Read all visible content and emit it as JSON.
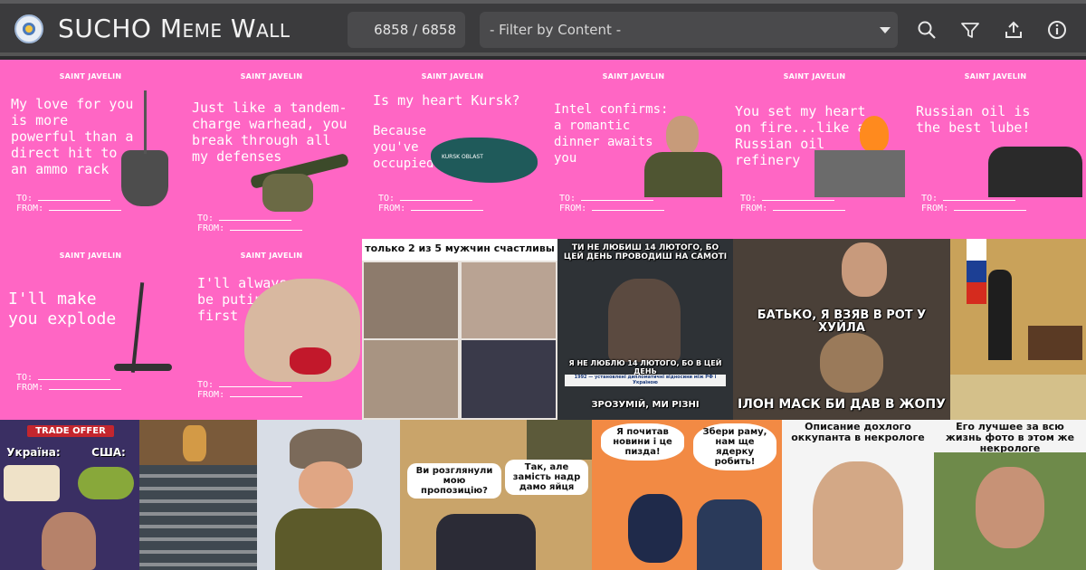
{
  "header": {
    "title": "SUCHO Meme Wall",
    "counter": "6858 / 6858",
    "filter_value": "- Filter by Content -",
    "icons": [
      "search-icon",
      "filter-icon",
      "upload-icon",
      "info-icon"
    ]
  },
  "colors": {
    "accent_pink": "#ff66c4",
    "header_bg": "#3b3b3d"
  },
  "cards": [
    {
      "brand": "SAINT JAVELIN",
      "text": "My love for you is more powerful than a direct hit to an ammo rack",
      "to": "TO:",
      "from": "FROM:"
    },
    {
      "brand": "SAINT JAVELIN",
      "text": "Just like a tandem-charge warhead, you break through all my defenses",
      "to": "TO:",
      "from": "FROM:"
    },
    {
      "brand": "SAINT JAVELIN",
      "text": "Is my heart Kursk?",
      "text2": "Because you've occupied it",
      "to": "TO:",
      "from": "FROM:",
      "map_label": "KURSK OBLAST"
    },
    {
      "brand": "SAINT JAVELIN",
      "text": "Intel confirms: a romantic dinner awaits you",
      "to": "TO:",
      "from": "FROM:"
    },
    {
      "brand": "SAINT JAVELIN",
      "text": "You set my heart on fire...like a Russian oil refinery",
      "to": "TO:",
      "from": "FROM:"
    },
    {
      "brand": "SAINT JAVELIN",
      "text": "Russian oil is the best lube!",
      "to": "TO:",
      "from": "FROM:"
    },
    {
      "brand": "SAINT JAVELIN",
      "text": "I'll make you explode",
      "to": "TO:",
      "from": "FROM:"
    },
    {
      "brand": "SAINT JAVELIN",
      "text": "I'll always be putin you first",
      "to": "TO:",
      "from": "FROM:"
    }
  ],
  "memes": {
    "m1_top": "только 2 из 5 мужчин счастливы",
    "m2_top": "ТИ НЕ ЛЮБИШ 14 ЛЮТОГО, БО ЦЕЙ ДЕНЬ ПРОВОДИШ НА САМОТІ",
    "m2_mid": "Я НЕ ЛЮБЛЮ 14 ЛЮТОГО, БО В ЦЕЙ ДЕНЬ",
    "m2_small": "1992 — установлені дипломатичні відносини між РФ і Україною",
    "m2_bottom": "ЗРОЗУМІЙ, МИ РІЗНІ",
    "m3_top": "БАТЬКО, Я ВЗЯВ В РОТ У ХУЙЛА",
    "m3_bottom": "ІЛОН МАСК БИ ДАВ В ЖОПУ",
    "m5_badge": "TRADE OFFER",
    "m5_left": "Україна:",
    "m5_right": "США:",
    "m8_bubble1": "Ви розглянули мою пропозицію?",
    "m8_bubble2": "Так, але замість надр дамо яйця",
    "m9_left": "Я почитав новини і це пизда!",
    "m9_right": "Збери раму, нам ще ядерку робить!",
    "m10_left": "Описание дохлого оккупанта в некрологе",
    "m10_right": "Его лучшее за всю жизнь фото в этом же некрологе"
  }
}
